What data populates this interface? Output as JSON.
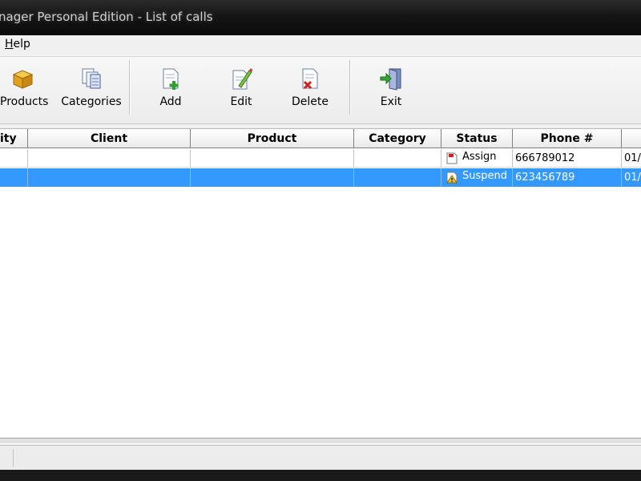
{
  "window": {
    "title": "nager Personal Edition - List of calls"
  },
  "menu": {
    "items": [
      {
        "label_underlined": "H",
        "label_rest": "elp"
      }
    ]
  },
  "toolbar": {
    "products": "Products",
    "categories": "Categories",
    "add": "Add",
    "edit": "Edit",
    "delete": "Delete",
    "exit": "Exit"
  },
  "grid": {
    "columns": [
      "ity",
      "Client",
      "Product",
      "Category",
      "Status",
      "Phone #",
      ""
    ],
    "rows": [
      {
        "status": "Assign",
        "status_icon": "assign-icon",
        "phone": "666789012",
        "date": "01/",
        "selected": false
      },
      {
        "status": "Suspend",
        "status_icon": "suspend-warning-icon",
        "phone": "623456789",
        "date": "01/",
        "selected": true
      }
    ]
  },
  "colors": {
    "selection": "#3399ff",
    "title_bar": "#151515"
  }
}
